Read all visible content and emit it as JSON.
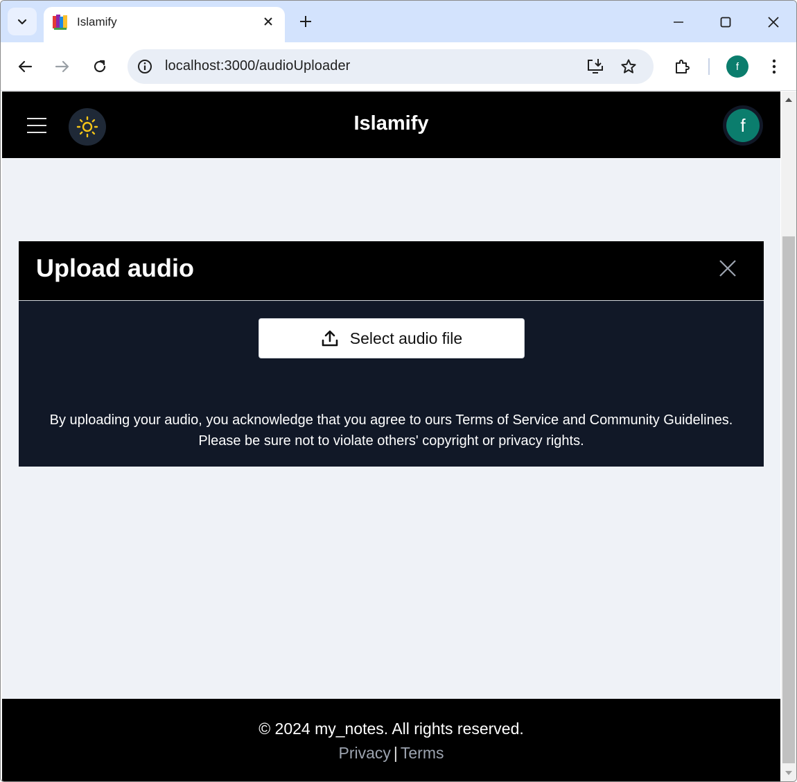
{
  "browser": {
    "tab": {
      "title": "Islamify"
    },
    "address_bar": {
      "url": "localhost:3000/audioUploader"
    },
    "profile_initial": "f"
  },
  "app": {
    "brand": "Islamify",
    "avatar_initial": "f"
  },
  "upload_card": {
    "title": "Upload audio",
    "select_button_label": "Select audio file",
    "disclaimer": "By uploading your audio, you acknowledge that you agree to ours Terms of Service and Community Guidelines. Please be sure not to violate others' copyright or privacy rights."
  },
  "footer": {
    "copyright": "© 2024 my_notes. All rights reserved.",
    "links": [
      "Privacy",
      "Terms"
    ],
    "separator": "|"
  },
  "colors": {
    "header_bg": "#000000",
    "card_body_bg": "#111827",
    "page_bg": "#eff2f7",
    "avatar": "#0b7d6d",
    "sun": "#f5c518"
  },
  "icons": [
    "tab-search-icon",
    "favicon-icon",
    "close-tab-icon",
    "new-tab-icon",
    "minimize-icon",
    "maximize-icon",
    "close-window-icon",
    "back-icon",
    "forward-icon",
    "reload-icon",
    "site-info-icon",
    "install-app-icon",
    "bookmark-star-icon",
    "extensions-icon",
    "kebab-menu-icon",
    "hamburger-menu-icon",
    "sun-icon",
    "close-icon",
    "upload-icon"
  ]
}
